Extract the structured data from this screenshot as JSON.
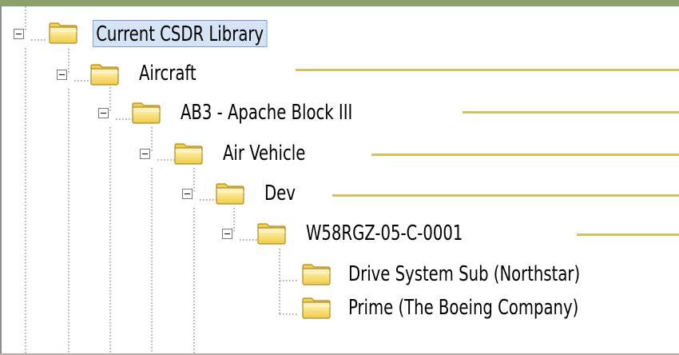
{
  "tree": {
    "root": {
      "label": "Current CSDR Library"
    },
    "nodes": [
      {
        "label": "Aircraft"
      },
      {
        "label": "AB3 - Apache Block III"
      },
      {
        "label": "Air Vehicle"
      },
      {
        "label": "Dev"
      },
      {
        "label": "W58RGZ-05-C-0001"
      },
      {
        "label": "Drive System Sub (Northstar)"
      },
      {
        "label": "Prime (The Boeing Company)"
      }
    ]
  },
  "colors": {
    "frame": "#8ea06a",
    "callout_line": "#d4c15c",
    "selection_bg": "#d4e4f6",
    "selection_border": "#6e9ad4",
    "folder_fill": "#f6d55a"
  },
  "icons": {
    "folder": "folder-icon",
    "expander": "collapse-icon"
  }
}
